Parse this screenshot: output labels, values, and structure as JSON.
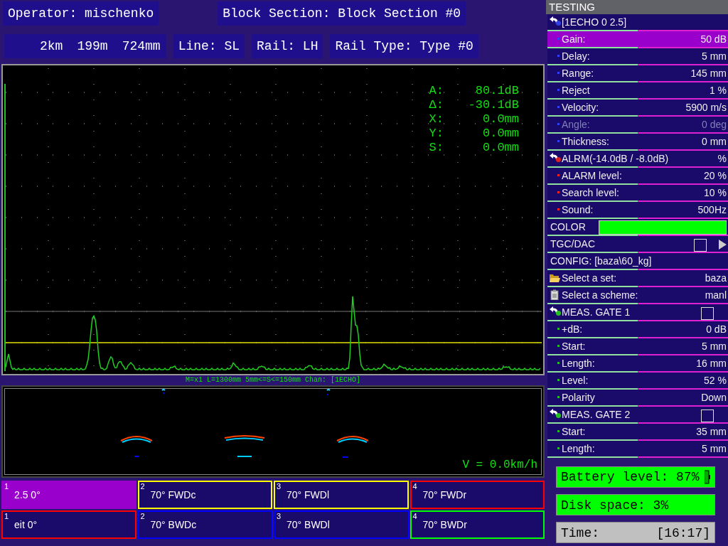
{
  "header": {
    "operator": "Operator: mischenko",
    "block_section": "Block Section: Block Section #0",
    "distance": [
      "2km",
      "199m",
      "724mm"
    ],
    "line": "Line: SL",
    "rail": "Rail: LH",
    "rail_type": "Rail Type: Type #0"
  },
  "scope": {
    "readouts": [
      {
        "label": "A:",
        "value": "80.1dB"
      },
      {
        "label": "Δ:",
        "value": "-30.1dB"
      },
      {
        "label": "X:",
        "value": "0.0mm"
      },
      {
        "label": "Y:",
        "value": "0.0mm"
      },
      {
        "label": "S:",
        "value": "0.0mm"
      }
    ]
  },
  "bscan": {
    "info": "M=x1  L=1300mm 5mm<=S<=150mm Chan: [1ECHO]",
    "speed": "V = 0.0km/h"
  },
  "channels": [
    [
      {
        "number": "1",
        "label": "2.5 0°",
        "color": "#9900cc",
        "selected": true
      },
      {
        "number": "2",
        "label": "70° FWDc",
        "color": "#ffff00",
        "selected": false
      },
      {
        "number": "3",
        "label": "70° FWDl",
        "color": "#ffff00",
        "selected": false
      },
      {
        "number": "4",
        "label": "70° FWDr",
        "color": "#ff0000",
        "selected": false
      }
    ],
    [
      {
        "number": "1",
        "label": "eit 0°",
        "color": "#ff0000",
        "selected": false
      },
      {
        "number": "2",
        "label": "70° BWDc",
        "color": "#0000ff",
        "selected": false
      },
      {
        "number": "3",
        "label": "70° BWDl",
        "color": "#0000ff",
        "selected": false
      },
      {
        "number": "4",
        "label": "70° BWDr",
        "color": "#00ff00",
        "selected": false
      }
    ]
  ],
  "panel": {
    "title": "TESTING",
    "items": [
      {
        "kind": "group",
        "label": "[1ECHO 0 2.5]",
        "color": "#3040e0"
      },
      {
        "kind": "param",
        "label": "Gain:",
        "value": "50 dB",
        "color": "#3040ff",
        "selected": true,
        "disabled": false
      },
      {
        "kind": "param",
        "label": "Delay:",
        "value": "5 mm",
        "color": "#3040ff",
        "selected": false,
        "disabled": false
      },
      {
        "kind": "param",
        "label": "Range:",
        "value": "145 mm",
        "color": "#3040ff",
        "selected": false,
        "disabled": false
      },
      {
        "kind": "param",
        "label": "Reject",
        "value": "1 %",
        "color": "#3040ff",
        "selected": false,
        "disabled": false
      },
      {
        "kind": "param",
        "label": "Velocity:",
        "value": "5900 m/s",
        "color": "#3040ff",
        "selected": false,
        "disabled": false
      },
      {
        "kind": "param",
        "label": "Angle:",
        "value": "0 deg",
        "color": "#3040ff",
        "selected": false,
        "disabled": true
      },
      {
        "kind": "param",
        "label": "Thickness:",
        "value": "0 mm",
        "color": "#3040ff",
        "selected": false,
        "disabled": false
      },
      {
        "kind": "group",
        "label": "ALRM(-14.0dB / -8.0dB)",
        "value": "%",
        "color": "#e02020"
      },
      {
        "kind": "param",
        "label": "ALARM level:",
        "value": "20 %",
        "color": "#ff2020",
        "selected": false,
        "disabled": false
      },
      {
        "kind": "param",
        "label": "Search level:",
        "value": "10 %",
        "color": "#ff2020",
        "selected": false,
        "disabled": false
      },
      {
        "kind": "param",
        "label": "Sound:",
        "value": "500Hz",
        "color": "#ff2020",
        "selected": false,
        "disabled": false
      },
      {
        "kind": "swatch",
        "label": "COLOR",
        "color": "#00ff00"
      },
      {
        "kind": "toggle",
        "label": "TGC/DAC",
        "checked": false
      },
      {
        "kind": "text",
        "label": "CONFIG: [baza\\60_kg]"
      },
      {
        "kind": "folder",
        "label": "Select a set:",
        "value": "baza"
      },
      {
        "kind": "scheme",
        "label": "Select a scheme:",
        "value": "manl"
      },
      {
        "kind": "group",
        "label": "MEAS. GATE 1",
        "color": "#20c020",
        "checked": false
      },
      {
        "kind": "param",
        "label": "+dB:",
        "value": "0 dB",
        "color": "#20c020",
        "selected": false,
        "disabled": false
      },
      {
        "kind": "param",
        "label": "Start:",
        "value": "5 mm",
        "color": "#20c020",
        "selected": false,
        "disabled": false
      },
      {
        "kind": "param",
        "label": "Length:",
        "value": "16 mm",
        "color": "#20c020",
        "selected": false,
        "disabled": false
      },
      {
        "kind": "param",
        "label": "Level:",
        "value": "52 %",
        "color": "#20c020",
        "selected": false,
        "disabled": false
      },
      {
        "kind": "param",
        "label": "Polarity",
        "value": "Down",
        "color": "#20c020",
        "selected": false,
        "disabled": false
      },
      {
        "kind": "group",
        "label": "MEAS. GATE 2",
        "color": "#20c020",
        "checked": false
      },
      {
        "kind": "param",
        "label": "Start:",
        "value": "35 mm",
        "color": "#20c020",
        "selected": false,
        "disabled": false
      },
      {
        "kind": "param",
        "label": "Length:",
        "value": "5 mm",
        "color": "#20c020",
        "selected": false,
        "disabled": false
      }
    ]
  },
  "status": {
    "battery": "Battery level: 87%",
    "disk": "Disk space: 3%",
    "time_label": "Time:",
    "time": "[16:17]"
  }
}
